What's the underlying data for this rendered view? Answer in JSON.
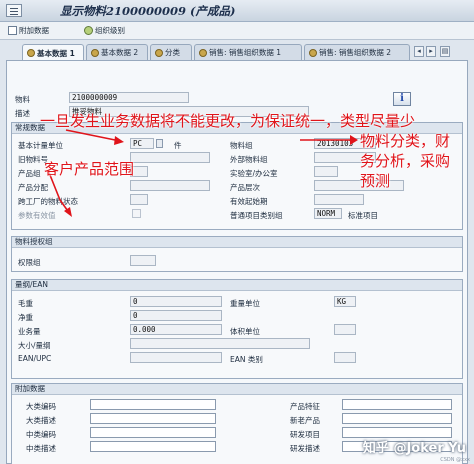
{
  "window": {
    "title": "显示物料2100000009 (产成品)"
  },
  "toolbar": {
    "additional_data": "附加数据",
    "org_levels": "组织级别"
  },
  "tabs": [
    {
      "label": "基本数据 1"
    },
    {
      "label": "基本数据 2"
    },
    {
      "label": "分类"
    },
    {
      "label": "销售: 销售组织数据 1"
    },
    {
      "label": "销售: 销售组织数据 2"
    }
  ],
  "header": {
    "material_label": "物料",
    "material_value": "2100000009",
    "desc_label": "描述",
    "desc_value": "推妥物料"
  },
  "general": {
    "title": "常规数据",
    "base_uom_label": "基本计量单位",
    "base_uom_value": "PC",
    "base_uom_text": "件",
    "old_mat_label": "旧物料号",
    "division_label": "产品组",
    "alloc_label": "产品分配",
    "xplant_label": "跨工厂的物料状态",
    "ref_lbl": "参数有效值",
    "matgroup_label": "物料组",
    "matgroup_value": "20130103",
    "ext_group_label": "外部物料组",
    "lab_label": "实验室/办公室",
    "hier_label": "产品层次",
    "valid_label": "有效起始期",
    "item_cat_label": "普通项目类别组",
    "item_cat_value": "NORM",
    "item_cat_text": "标准项目"
  },
  "auth": {
    "title": "物料授权组",
    "label": "权限组"
  },
  "dims": {
    "title": "量纲/EAN",
    "gross_label": "毛重",
    "gross_value": "0",
    "net_label": "净重",
    "net_value": "0",
    "volume_label": "业务量",
    "volume_value": "0.000",
    "size_label": "大小/量纲",
    "ean_label": "EAN/UPC",
    "weight_unit_label": "重量单位",
    "weight_unit_value": "KG",
    "volume_unit_label": "体积单位",
    "ean_cat_label": "EAN 类别"
  },
  "extra": {
    "title": "附加数据",
    "l1": "大类编码",
    "l2": "大类描述",
    "l3": "中类编码",
    "l4": "中类描述",
    "r1": "产品特征",
    "r2": "新老产品",
    "r3": "研发项目",
    "r4": "研发描述"
  },
  "annotations": {
    "a1": "一旦发生业务数据将不能更改，为保证统一，类型尽量少",
    "a2": "物料分类，财",
    "a3": "务分析，采购",
    "a4": "预测",
    "a5": "客户产品范围"
  },
  "watermark": {
    "text": "知乎 @Joker Yu",
    "csdn": "CSDN @xxx"
  }
}
